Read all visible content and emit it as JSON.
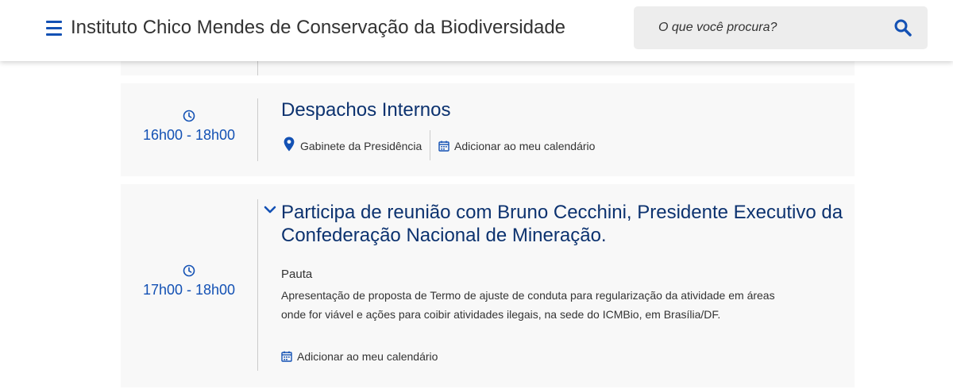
{
  "header": {
    "site_title": "Instituto Chico Mendes de Conservação da Biodiversidade",
    "search_placeholder": "O que você procura?",
    "menu_icon": "menu-icon",
    "search_icon": "search-icon",
    "accent_color": "#1351b4"
  },
  "events": [
    {
      "time": "16h00 - 18h00",
      "title": "Despachos Internos",
      "location": "Gabinete da Presidência",
      "calendar_label": "Adicionar ao meu calendário"
    },
    {
      "time": "17h00 - 18h00",
      "title": "Participa de reunião com Bruno Cecchini, Presidente Executivo da Confederação Nacional de Mineração.",
      "pauta_label": "Pauta",
      "pauta_text": "Apresentação de proposta de Termo de ajuste de conduta para regularização da atividade em áreas onde for viável e ações para coibir atividades ilegais, na sede do ICMBio, em Brasília/DF.",
      "calendar_label": "Adicionar ao meu calendário"
    }
  ],
  "colors": {
    "title_color": "#0c326f",
    "time_color": "#1351b4",
    "card_bg": "#f8f8f8"
  }
}
